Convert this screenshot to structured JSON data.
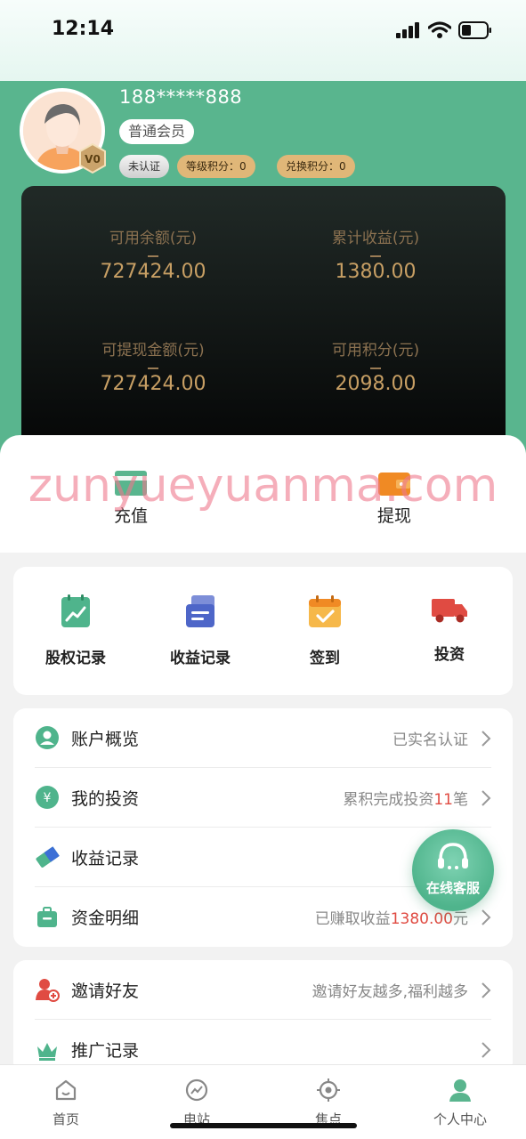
{
  "status_bar": {
    "time": "12:14"
  },
  "profile": {
    "phone": "188*****888",
    "member_level": "普通会员",
    "vip_badge": "V0",
    "verify_status": "未认证",
    "level_points": "等级积分：0",
    "exchange_points": "兑换积分：0"
  },
  "balance": {
    "items": [
      {
        "label": "可用余额(元)",
        "value": "727424.00"
      },
      {
        "label": "累计收益(元)",
        "value": "1380.00"
      },
      {
        "label": "可提现金额(元)",
        "value": "727424.00"
      },
      {
        "label": "可用积分(元)",
        "value": "2098.00"
      }
    ]
  },
  "actions": {
    "recharge": "充值",
    "withdraw": "提现"
  },
  "watermark": "zunyueyuanma.com",
  "features": [
    {
      "label": "股权记录",
      "icon": "equity-chart-icon"
    },
    {
      "label": "收益记录",
      "icon": "income-list-icon"
    },
    {
      "label": "签到",
      "icon": "calendar-check-icon"
    },
    {
      "label": "投资",
      "icon": "truck-icon"
    }
  ],
  "menu1": [
    {
      "label": "账户概览",
      "value": "已实名认证"
    },
    {
      "label": "我的投资",
      "value_prefix": "累积完成投资",
      "value_highlight": "11",
      "value_suffix": "笔"
    },
    {
      "label": "收益记录",
      "value": ""
    },
    {
      "label": "资金明细",
      "value_prefix": "已赚取收益",
      "value_highlight": "1380.00",
      "value_suffix": "元"
    }
  ],
  "menu2": [
    {
      "label": "邀请好友",
      "value": "邀请好友越多,福利越多"
    },
    {
      "label": "推广记录",
      "value": ""
    }
  ],
  "customer_service": {
    "label": "在线客服"
  },
  "tabbar": [
    {
      "label": "首页",
      "icon": "home-icon"
    },
    {
      "label": "电站",
      "icon": "power-station-icon"
    },
    {
      "label": "焦点",
      "icon": "focus-target-icon"
    },
    {
      "label": "个人中心",
      "icon": "user-center-icon"
    }
  ],
  "colors": {
    "primary_green": "#59b58e",
    "gold": "#c79f64",
    "highlight_red": "#e04b42"
  }
}
